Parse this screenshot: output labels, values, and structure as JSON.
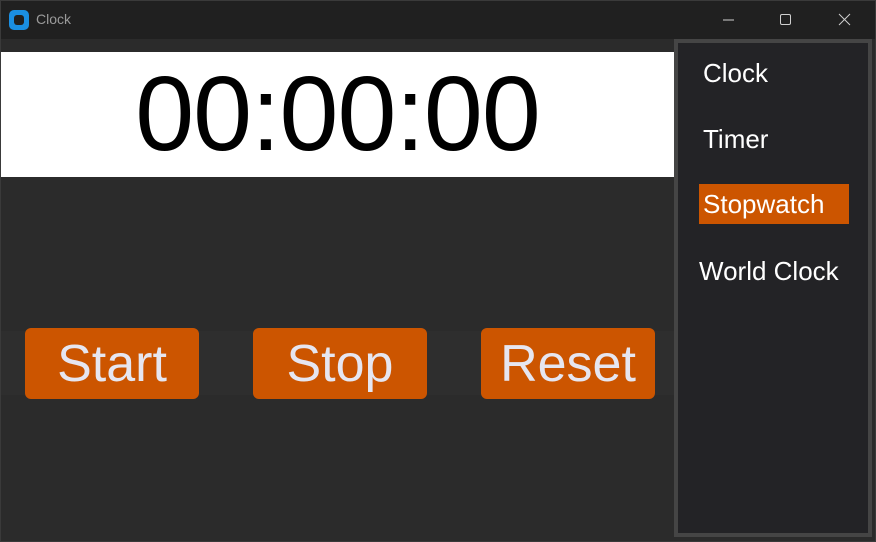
{
  "window": {
    "title": "Clock"
  },
  "stopwatch": {
    "time": "00:00:00"
  },
  "controls": {
    "start_label": "Start",
    "stop_label": "Stop",
    "reset_label": "Reset"
  },
  "sidebar": {
    "items": [
      {
        "label": "Clock",
        "selected": false
      },
      {
        "label": "Timer",
        "selected": false
      },
      {
        "label": "Stopwatch",
        "selected": true
      },
      {
        "label": "World Clock",
        "selected": false
      }
    ]
  },
  "colors": {
    "accent": "#cc5500",
    "background": "#2b2b2b",
    "titlebar": "#202020",
    "sidebar": "#232326",
    "app_icon": "#1a8fe3"
  },
  "icons": {
    "app": "clock-app-icon",
    "minimize": "minimize-icon",
    "maximize": "maximize-icon",
    "close": "close-icon"
  }
}
